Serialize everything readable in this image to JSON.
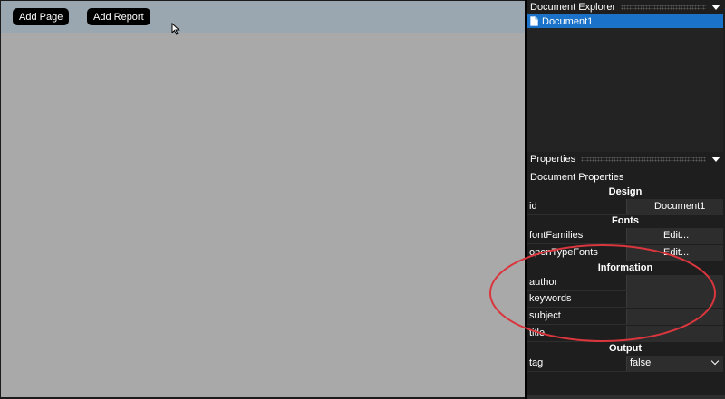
{
  "toolbar": {
    "add_page": "Add Page",
    "add_report": "Add Report"
  },
  "document_explorer": {
    "title": "Document Explorer",
    "items": [
      {
        "label": "Document1",
        "selected": true
      }
    ]
  },
  "properties": {
    "title": "Properties",
    "subtitle": "Document Properties",
    "sections": {
      "design": "Design",
      "fonts": "Fonts",
      "information": "Information",
      "output": "Output"
    },
    "rows": {
      "id": {
        "label": "id",
        "value": "Document1"
      },
      "fontFamilies": {
        "label": "fontFamilies",
        "value": "Edit..."
      },
      "openTypeFonts": {
        "label": "openTypeFonts",
        "value": "Edit..."
      },
      "author": {
        "label": "author",
        "value": ""
      },
      "keywords": {
        "label": "keywords",
        "value": ""
      },
      "subject": {
        "label": "subject",
        "value": ""
      },
      "title": {
        "label": "title",
        "value": ""
      },
      "tag": {
        "label": "tag",
        "value": "false"
      }
    }
  },
  "colors": {
    "canvas": "#a9a9a9",
    "toolbar": "#9aa7b0",
    "selection": "#1a73c8",
    "annotation": "#d9363e"
  }
}
